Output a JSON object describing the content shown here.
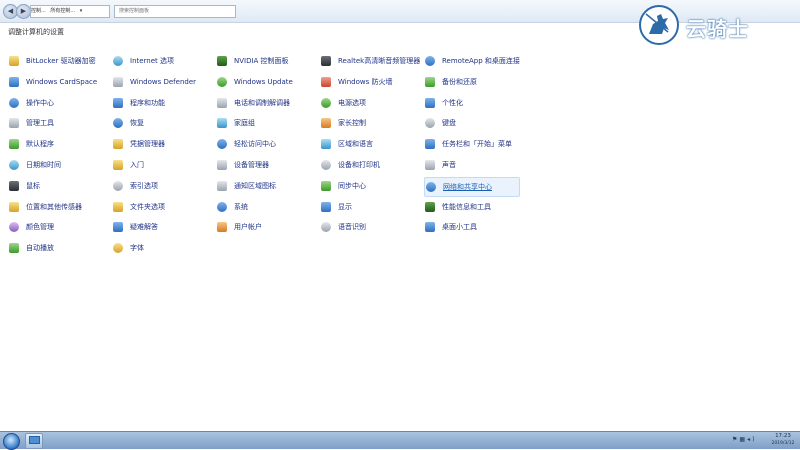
{
  "address_bar": {
    "breadcrumb": [
      "控制...",
      "所有控制...",
      "▾"
    ],
    "search_placeholder": "搜索控制面板"
  },
  "page_title": "调整计算机的设置",
  "watermark_text": "云骑士",
  "items": [
    {
      "label": "BitLocker 驱动器加密",
      "icon": "bitlocker-key-icon",
      "color": "ico-y"
    },
    {
      "label": "Internet 选项",
      "icon": "internet-globe-icon",
      "color": "ico-c"
    },
    {
      "label": "NVIDIA 控制面板",
      "icon": "nvidia-icon",
      "color": "ico-n"
    },
    {
      "label": "Realtek高清晰音频管理器",
      "icon": "realtek-audio-icon",
      "color": "ico-k"
    },
    {
      "label": "RemoteApp 和桌面连接",
      "icon": "remoteapp-icon",
      "color": "ico-b"
    },
    {
      "label": "Windows CardSpace",
      "icon": "cardspace-icon",
      "color": "ico-b"
    },
    {
      "label": "Windows Defender",
      "icon": "defender-icon",
      "color": "ico-gr"
    },
    {
      "label": "Windows Update",
      "icon": "windows-update-icon",
      "color": "ico-g"
    },
    {
      "label": "Windows 防火墙",
      "icon": "firewall-icon",
      "color": "ico-r"
    },
    {
      "label": "备份和还原",
      "icon": "backup-icon",
      "color": "ico-g"
    },
    {
      "label": "操作中心",
      "icon": "action-center-flag-icon",
      "color": "ico-b"
    },
    {
      "label": "程序和功能",
      "icon": "programs-icon",
      "color": "ico-b"
    },
    {
      "label": "电话和调制解调器",
      "icon": "phone-modem-icon",
      "color": "ico-gr"
    },
    {
      "label": "电源选项",
      "icon": "power-options-icon",
      "color": "ico-g"
    },
    {
      "label": "个性化",
      "icon": "personalization-icon",
      "color": "ico-b"
    },
    {
      "label": "管理工具",
      "icon": "admin-tools-icon",
      "color": "ico-gr"
    },
    {
      "label": "恢复",
      "icon": "recovery-icon",
      "color": "ico-b"
    },
    {
      "label": "家庭组",
      "icon": "homegroup-icon",
      "color": "ico-c"
    },
    {
      "label": "家长控制",
      "icon": "parental-controls-icon",
      "color": "ico-o"
    },
    {
      "label": "键盘",
      "icon": "keyboard-icon",
      "color": "ico-gr"
    },
    {
      "label": "默认程序",
      "icon": "default-programs-icon",
      "color": "ico-g"
    },
    {
      "label": "凭据管理器",
      "icon": "credential-manager-icon",
      "color": "ico-y"
    },
    {
      "label": "轻松访问中心",
      "icon": "ease-of-access-icon",
      "color": "ico-b"
    },
    {
      "label": "区域和语言",
      "icon": "region-language-icon",
      "color": "ico-c"
    },
    {
      "label": "任务栏和「开始」菜单",
      "icon": "taskbar-start-icon",
      "color": "ico-b"
    },
    {
      "label": "日期和时间",
      "icon": "date-time-icon",
      "color": "ico-c"
    },
    {
      "label": "入门",
      "icon": "getting-started-icon",
      "color": "ico-y"
    },
    {
      "label": "设备管理器",
      "icon": "device-manager-icon",
      "color": "ico-gr"
    },
    {
      "label": "设备和打印机",
      "icon": "devices-printers-icon",
      "color": "ico-gr"
    },
    {
      "label": "声音",
      "icon": "sound-icon",
      "color": "ico-gr"
    },
    {
      "label": "鼠标",
      "icon": "mouse-icon",
      "color": "ico-k"
    },
    {
      "label": "索引选项",
      "icon": "indexing-icon",
      "color": "ico-gr"
    },
    {
      "label": "通知区域图标",
      "icon": "notification-area-icon",
      "color": "ico-gr"
    },
    {
      "label": "同步中心",
      "icon": "sync-center-icon",
      "color": "ico-g"
    },
    {
      "label": "网络和共享中心",
      "icon": "network-sharing-icon",
      "color": "ico-b"
    },
    {
      "label": "位置和其他传感器",
      "icon": "location-sensors-icon",
      "color": "ico-y"
    },
    {
      "label": "文件夹选项",
      "icon": "folder-options-icon",
      "color": "ico-y"
    },
    {
      "label": "系统",
      "icon": "system-icon",
      "color": "ico-b"
    },
    {
      "label": "显示",
      "icon": "display-icon",
      "color": "ico-b"
    },
    {
      "label": "性能信息和工具",
      "icon": "performance-icon",
      "color": "ico-n"
    },
    {
      "label": "颜色管理",
      "icon": "color-management-icon",
      "color": "ico-p"
    },
    {
      "label": "疑难解答",
      "icon": "troubleshooting-icon",
      "color": "ico-b"
    },
    {
      "label": "用户帐户",
      "icon": "user-accounts-icon",
      "color": "ico-o"
    },
    {
      "label": "语音识别",
      "icon": "speech-recognition-icon",
      "color": "ico-gr"
    },
    {
      "label": "桌面小工具",
      "icon": "gadgets-icon",
      "color": "ico-b"
    },
    {
      "label": "自动播放",
      "icon": "autoplay-icon",
      "color": "ico-g"
    },
    {
      "label": "字体",
      "icon": "fonts-icon",
      "color": "ico-y"
    }
  ],
  "hovered_item": "网络和共享中心",
  "taskbar": {
    "clock_time": "17:23",
    "clock_date": "2019/3/12"
  }
}
